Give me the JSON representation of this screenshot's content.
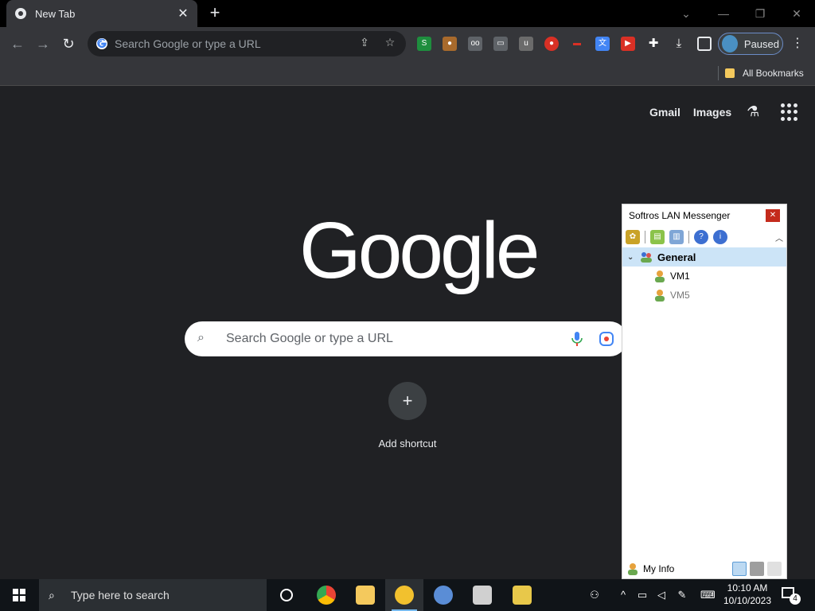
{
  "browser": {
    "tab": {
      "title": "New Tab"
    },
    "omnibox": {
      "placeholder": "Search Google or type a URL"
    },
    "profile": {
      "label": "Paused"
    },
    "bookmarks": {
      "all_label": "All Bookmarks"
    },
    "extensions": [
      "sheets-ext-icon",
      "cookie-ext-icon",
      "reader-ext-icon",
      "printer-ext-icon",
      "ublock-ext-icon",
      "record-ext-icon",
      "red-ext-icon",
      "translate-ext-icon",
      "youtube-ext-icon",
      "puzzle-icon",
      "download-icon",
      "sidepanel-icon"
    ]
  },
  "ntp": {
    "links": {
      "gmail": "Gmail",
      "images": "Images"
    },
    "logo": "Google",
    "search_placeholder": "Search Google or type a URL",
    "add_shortcut": "Add shortcut"
  },
  "lan_messenger": {
    "title": "Softros LAN Messenger",
    "group": "General",
    "users": [
      "VM1",
      "VM5"
    ],
    "footer_label": "My Info"
  },
  "taskbar": {
    "search_placeholder": "Type here to search",
    "clock_time": "10:10 AM",
    "clock_date": "10/10/2023",
    "notification_count": "4"
  },
  "colors": {
    "accent_blue": "#76b9ed",
    "close_red": "#c42b1c",
    "group_highlight": "#cce4f7"
  }
}
